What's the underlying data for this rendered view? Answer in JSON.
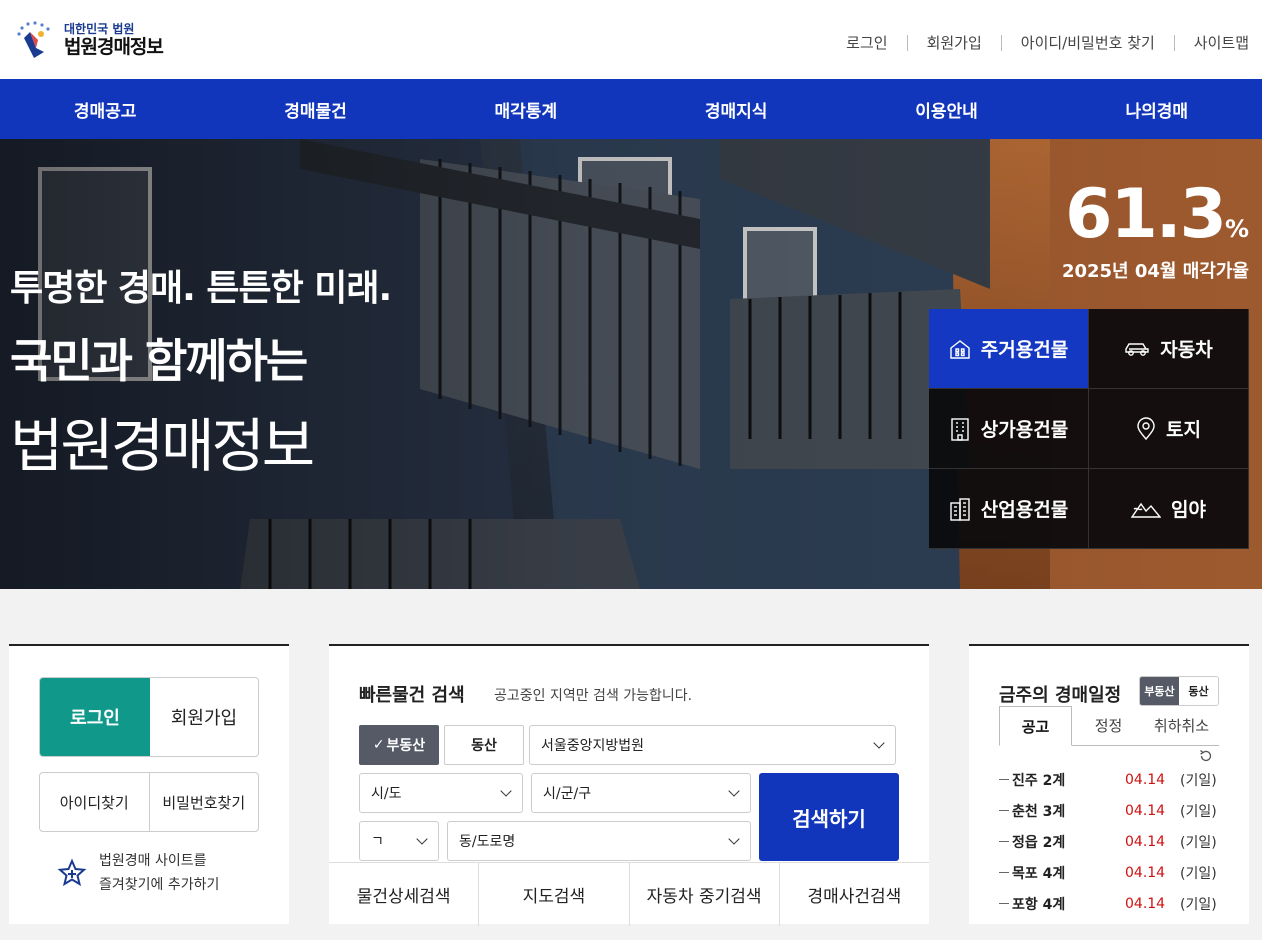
{
  "header": {
    "logo_sub": "대한민국 법원",
    "logo_main": "법원경매정보",
    "util": [
      "로그인",
      "회원가입",
      "아이디/비밀번호 찾기",
      "사이트맵"
    ]
  },
  "gnb": [
    "경매공고",
    "경매물건",
    "매각통계",
    "경매지식",
    "이용안내",
    "나의경매"
  ],
  "hero": {
    "line1": "투명한 경매. 튼튼한 미래.",
    "line2": "국민과 함께하는",
    "line3": "법원경매정보",
    "rate_value": "61.3",
    "rate_unit": "%",
    "rate_label": "2025년 04월 매각가율",
    "categories": [
      {
        "label": "주거용건물",
        "icon": "house-icon"
      },
      {
        "label": "자동차",
        "icon": "car-icon"
      },
      {
        "label": "상가용건물",
        "icon": "building-icon"
      },
      {
        "label": "토지",
        "icon": "map-pin-icon"
      },
      {
        "label": "산업용건물",
        "icon": "factory-icon"
      },
      {
        "label": "임야",
        "icon": "mountain-icon"
      }
    ]
  },
  "login_panel": {
    "login": "로그인",
    "join": "회원가입",
    "find_id": "아이디찾기",
    "find_pw": "비밀번호찾기",
    "fav_line1": "법원경매 사이트를",
    "fav_line2": "즐겨찾기에 추가하기"
  },
  "search": {
    "title": "빠른물건 검색",
    "desc": "공고중인 지역만 검색 가능합니다.",
    "type_real": "부동산",
    "type_movable": "동산",
    "court": "서울중앙지방법원",
    "sido": "시/도",
    "sigungu": "시/군/구",
    "initial": "ㄱ",
    "dong": "동/도로명",
    "button": "검색하기",
    "tabs": [
      "물건상세검색",
      "지도검색",
      "자동차 중기검색",
      "경매사건검색"
    ]
  },
  "schedule": {
    "title": "금주의 경매일정",
    "toggle_real": "부동산",
    "toggle_movable": "동산",
    "tabs": [
      "공고",
      "정정",
      "취하취소"
    ],
    "rows": [
      {
        "name": "진주 2계",
        "date": "04.14",
        "note": "(기일)"
      },
      {
        "name": "춘천 3계",
        "date": "04.14",
        "note": "(기일)"
      },
      {
        "name": "정읍 2계",
        "date": "04.14",
        "note": "(기일)"
      },
      {
        "name": "목포 4계",
        "date": "04.14",
        "note": "(기일)"
      },
      {
        "name": "포항 4계",
        "date": "04.14",
        "note": "(기일)"
      }
    ]
  },
  "colors": {
    "brand_blue": "#1136bb",
    "login_green": "#10998b",
    "date_red": "#d01010"
  }
}
